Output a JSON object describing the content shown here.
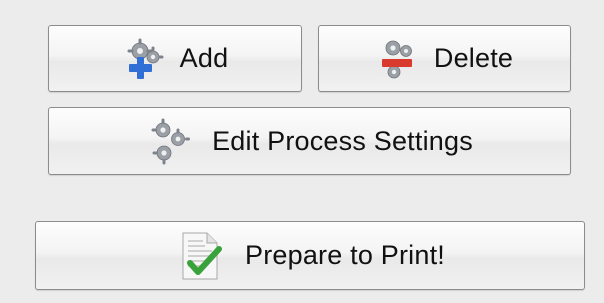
{
  "buttons": {
    "add": {
      "label": "Add",
      "icon": "gears-add-icon"
    },
    "delete": {
      "label": "Delete",
      "icon": "gears-delete-icon"
    },
    "edit": {
      "label": "Edit Process Settings",
      "icon": "gears-icon"
    },
    "print": {
      "label": "Prepare to Print!",
      "icon": "document-checkmark-icon"
    }
  },
  "colors": {
    "add_accent": "#2f6fd6",
    "delete_accent": "#d83a2e",
    "check_accent": "#3aa23a",
    "background": "#ececec"
  }
}
